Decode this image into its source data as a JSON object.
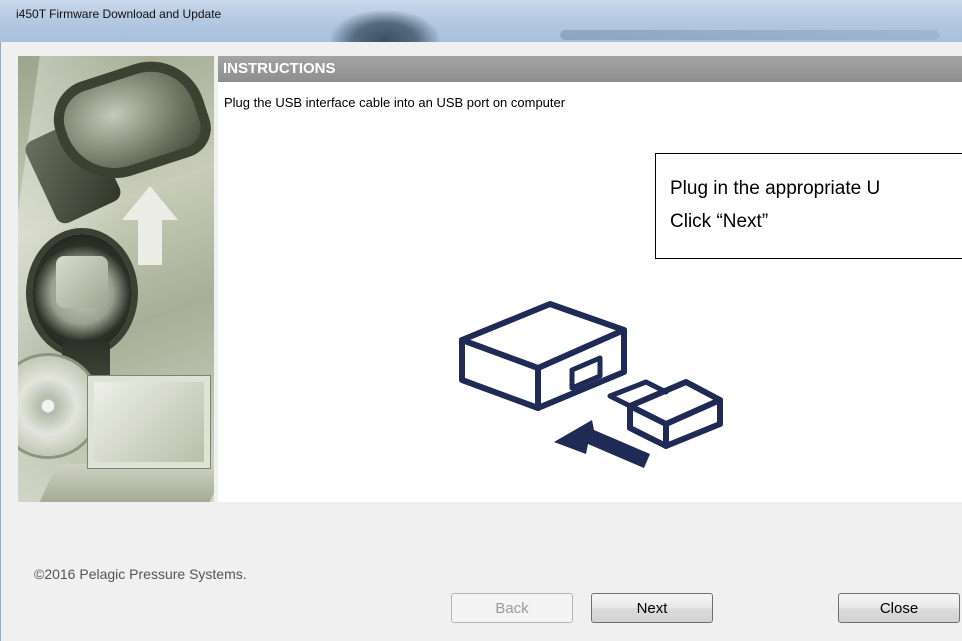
{
  "window": {
    "title": "i450T Firmware Download and Update"
  },
  "instructions": {
    "header": "INSTRUCTIONS",
    "text": "Plug the USB interface cable into an USB port on computer"
  },
  "callout": {
    "line1": "Plug in the appropriate U",
    "line2": "Click “Next”"
  },
  "footer": {
    "copyright": "©2016 Pelagic Pressure Systems."
  },
  "buttons": {
    "back": "Back",
    "next": "Next",
    "close": "Close"
  },
  "colors": {
    "header_bg": "#9a9a9a",
    "illustration_stroke": "#1f2a55"
  }
}
